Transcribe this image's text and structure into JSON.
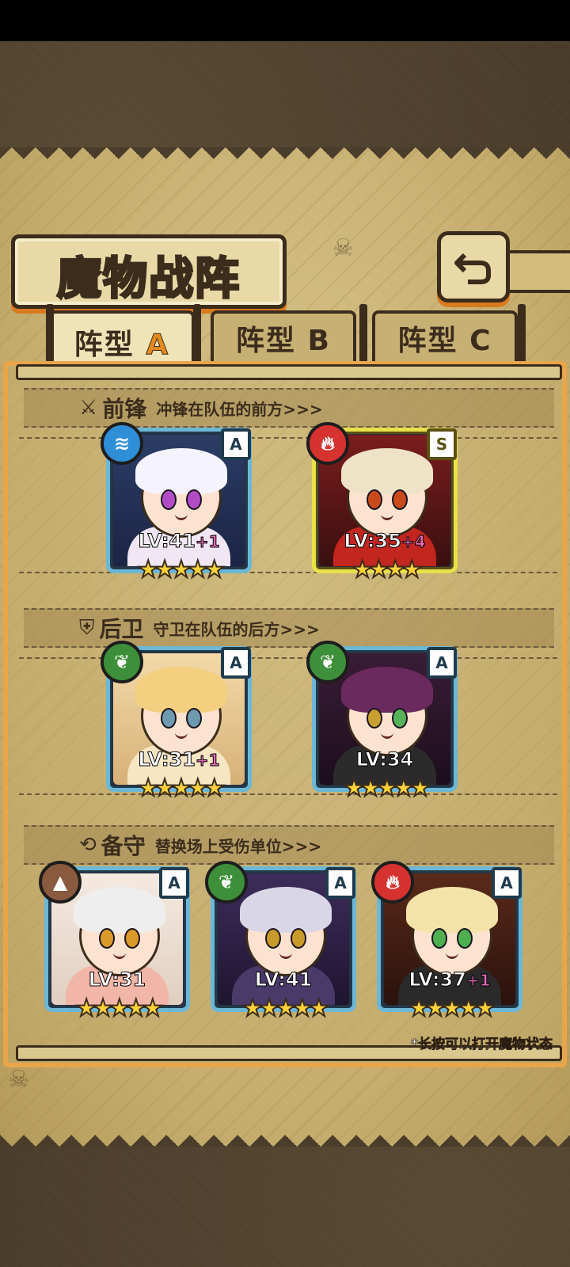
{
  "screen": {
    "title": "魔物战阵",
    "back_icon": "back-arrow-icon"
  },
  "tabs": [
    {
      "label": "阵型",
      "letter": "A",
      "active": true
    },
    {
      "label": "阵型",
      "letter": "B",
      "active": false
    },
    {
      "label": "阵型",
      "letter": "C",
      "active": false
    }
  ],
  "sections": {
    "vanguard": {
      "title": "前锋",
      "desc": "冲锋在队伍的前方>>>",
      "icon": "sword-icon"
    },
    "rear": {
      "title": "后卫",
      "desc": "守卫在队伍的后方>>>",
      "icon": "shield-icon"
    },
    "reserve": {
      "title": "备守",
      "desc": "替换场上受伤单位>>>",
      "icon": "swap-icon"
    }
  },
  "cards": {
    "v1": {
      "element": "water",
      "rank": "A",
      "lv": "LV:41",
      "plus": "+1",
      "stars": "★★★★★"
    },
    "v2": {
      "element": "fire",
      "rank": "S",
      "lv": "LV:35",
      "plus": "+4",
      "stars": "★★★★"
    },
    "r1": {
      "element": "wood",
      "rank": "A",
      "lv": "LV:31",
      "plus": "+1",
      "stars": "★★★★★"
    },
    "r2": {
      "element": "wood",
      "rank": "A",
      "lv": "LV:34",
      "plus": "",
      "stars": "★★★★★"
    },
    "b1": {
      "element": "earth",
      "rank": "A",
      "lv": "LV:31",
      "plus": "",
      "stars": "★★★★★"
    },
    "b2": {
      "element": "wood",
      "rank": "A",
      "lv": "LV:41",
      "plus": "",
      "stars": "★★★★★"
    },
    "b3": {
      "element": "fire",
      "rank": "A",
      "lv": "LV:37",
      "plus": "+1",
      "stars": "★★★★★"
    }
  },
  "footnote": "*长按可以打开魔物状态",
  "colors": {
    "accent": "#e58a1c",
    "frame": "#3b2c1c",
    "card_border": "#6db7d6",
    "card_gold": "#e9e14a",
    "star": "#ffd23a"
  }
}
